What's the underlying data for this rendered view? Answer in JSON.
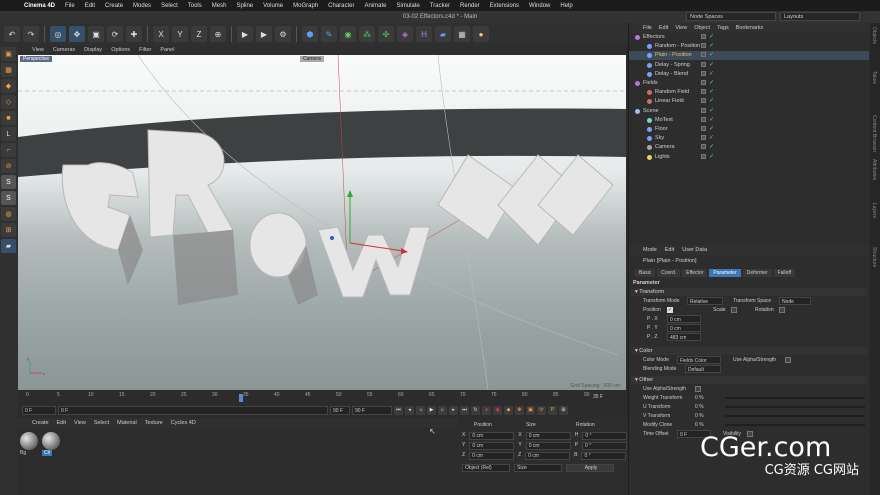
{
  "mac_menu": [
    "Cinema 4D",
    "File",
    "Edit",
    "Create",
    "Modes",
    "Select",
    "Tools",
    "Mesh",
    "Spline",
    "Volume",
    "MoGraph",
    "Character",
    "Animate",
    "Simulate",
    "Tracker",
    "Render",
    "Extensions",
    "Window",
    "Help"
  ],
  "window_title": "03-02 Effectors.c4d * - Main",
  "node_spaces": "Node Spaces",
  "layouts": "Layouts",
  "viewport": {
    "menu": [
      "View",
      "Cameras",
      "Display",
      "Options",
      "Filter",
      "Panel"
    ],
    "label": "Perspective",
    "camera_label": "Camera",
    "grid_spacing": "Grid Spacing : 500 cm",
    "scene_text": "GROWTH"
  },
  "timeline": {
    "ticks": [
      "0",
      "5",
      "10",
      "15",
      "20",
      "25",
      "30",
      "35",
      "40",
      "45",
      "50",
      "55",
      "60",
      "65",
      "70",
      "75",
      "80",
      "85",
      "90"
    ],
    "current_frame": "35 F",
    "start": "0 F",
    "field2": "0 F",
    "end": "90 F",
    "end2": "90 F"
  },
  "material_manager": {
    "menu": [
      "Create",
      "Edit",
      "View",
      "Select",
      "Material",
      "Texture",
      "Cycles 4D"
    ],
    "materials": [
      {
        "name": "Bg"
      },
      {
        "name": "Clr"
      }
    ]
  },
  "coordinates": {
    "headers": [
      "Position",
      "Size",
      "Rotation"
    ],
    "rows": [
      {
        "a": "X",
        "p": "0 cm",
        "b": "X",
        "s": "0 cm",
        "c": "H",
        "r": "0 °"
      },
      {
        "a": "Y",
        "p": "0 cm",
        "b": "Y",
        "s": "0 cm",
        "c": "P",
        "r": "0 °"
      },
      {
        "a": "Z",
        "p": "0 cm",
        "b": "Z",
        "s": "0 cm",
        "c": "B",
        "r": "0 °"
      }
    ],
    "mode": "Object (Rel)",
    "size_mode": "Size",
    "apply": "Apply"
  },
  "object_manager": {
    "tabs": [
      "File",
      "Edit",
      "View",
      "Object",
      "Tags",
      "Bookmarks"
    ],
    "objects": [
      {
        "name": "Effectors",
        "indent": 0,
        "color": "#b47ad6"
      },
      {
        "name": "Random - Position",
        "indent": 1,
        "color": "#7aa0ff"
      },
      {
        "name": "Plain - Position",
        "indent": 1,
        "color": "#7aa0ff",
        "selected": true
      },
      {
        "name": "Delay - Spring",
        "indent": 1,
        "color": "#7aa0ff"
      },
      {
        "name": "Delay - Blend",
        "indent": 1,
        "color": "#7aa0ff"
      },
      {
        "name": "Fields",
        "indent": 0,
        "color": "#b47ad6"
      },
      {
        "name": "Random Field",
        "indent": 1,
        "color": "#d66a6a"
      },
      {
        "name": "Linear Field",
        "indent": 1,
        "color": "#d66a6a"
      },
      {
        "name": "Scene",
        "indent": 0,
        "color": "#9ec2e6"
      },
      {
        "name": "MoText",
        "indent": 1,
        "color": "#7ad6c2"
      },
      {
        "name": "Floor",
        "indent": 1,
        "color": "#7aa0ff"
      },
      {
        "name": "Sky",
        "indent": 1,
        "color": "#7aa0ff"
      },
      {
        "name": "Camera",
        "indent": 1,
        "color": "#aaaaaa"
      },
      {
        "name": "Lights",
        "indent": 1,
        "color": "#f0d060"
      }
    ]
  },
  "attributes": {
    "tabs": [
      "Mode",
      "Edit",
      "User Data"
    ],
    "title": "Plain [Plain - Position]",
    "subtabs": [
      "Basic",
      "Coord.",
      "Effector",
      "Parameter",
      "Deformer",
      "Falloff"
    ],
    "active_subtab": "Parameter",
    "section_parameter": "Parameter",
    "section_transform": "▾ Transform",
    "transform_mode_label": "Transform Mode",
    "transform_mode": "Relative",
    "transform_space_label": "Transform Space",
    "transform_space": "Node",
    "position_label": "Position",
    "scale_label": "Scale",
    "rotation_label": "Rotation",
    "px": "P . X",
    "px_val": "0 cm",
    "py": "P . Y",
    "py_val": "0 cm",
    "pz": "P . Z",
    "pz_val": "483 cm",
    "section_color": "▾ Color",
    "color_mode_label": "Color Mode",
    "color_mode": "Fields Color",
    "use_alpha_label": "Use Alpha/Strength",
    "blending_label": "Blending Mode",
    "blending": "Default",
    "section_other": "▾ Other",
    "use_alpha2": "Use Alpha/Strength",
    "weight": "Weight Transform",
    "weight_val": "0 %",
    "utrans": "U Transform",
    "utrans_val": "0 %",
    "vtrans": "V Transform",
    "vtrans_val": "0 %",
    "modclone": "Modify Clone",
    "modclone_val": "0 %",
    "timeoffset": "Time Offset",
    "timeoffset_val": "0 F",
    "visibility": "Visibility"
  },
  "side_tabs": [
    "Objects",
    "Takes",
    "Content Browser",
    "Attributes",
    "Layers",
    "Structure"
  ],
  "watermark": {
    "line1": "CGer.com",
    "line2": "CG资源 CG网站"
  }
}
